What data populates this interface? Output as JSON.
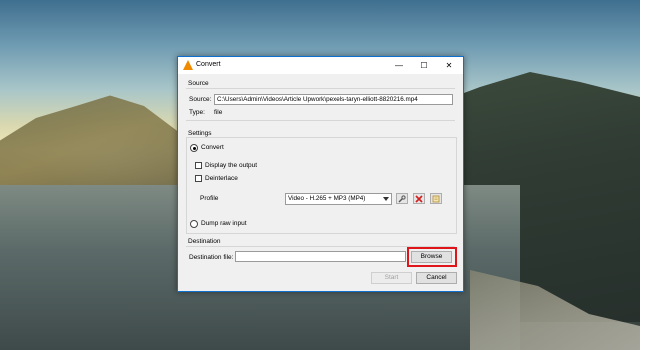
{
  "window": {
    "title": "Convert",
    "minimize_symbol": "—",
    "maximize_symbol": "☐",
    "close_symbol": "✕"
  },
  "source": {
    "section_label": "Source",
    "source_label": "Source:",
    "source_value": "C:\\Users\\Admin\\Videos\\Article Upwork\\pexels-taryn-elliott-8820216.mp4",
    "type_label": "Type:",
    "type_value": "file"
  },
  "settings": {
    "section_label": "Settings",
    "convert_label": "Convert",
    "convert_selected": true,
    "display_output_label": "Display the output",
    "display_output_checked": false,
    "deinterlace_label": "Deinterlace",
    "deinterlace_checked": false,
    "profile_label": "Profile",
    "profile_value": "Video - H.265 + MP3 (MP4)",
    "edit_icon": "wrench-icon",
    "delete_icon": "delete-x-icon",
    "new_icon": "new-profile-icon",
    "dump_raw_label": "Dump raw input",
    "dump_raw_selected": false
  },
  "destination": {
    "section_label": "Destination",
    "file_label": "Destination file:",
    "file_value": "",
    "browse_label": "Browse"
  },
  "footer": {
    "start_label": "Start",
    "start_enabled": false,
    "cancel_label": "Cancel"
  },
  "colors": {
    "highlight": "#e0151b",
    "window_border": "#0f6fcf",
    "delete_red": "#d21f1f"
  }
}
